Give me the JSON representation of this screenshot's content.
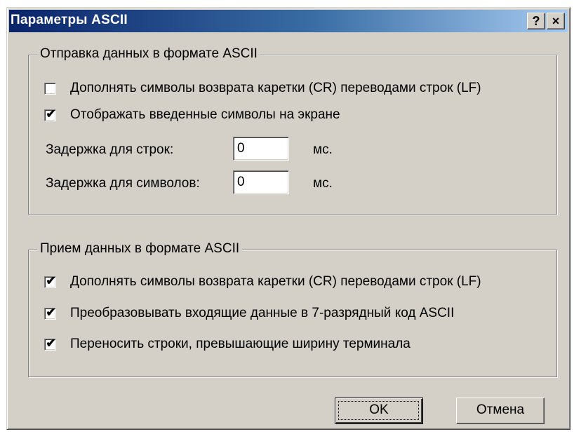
{
  "window": {
    "title": "Параметры ASCII",
    "help_glyph": "?",
    "close_glyph": "×"
  },
  "send_group": {
    "legend": "Отправка данных в формате ASCII",
    "options": [
      {
        "label": "Дополнять символы возврата каретки (CR) переводами строк (LF)",
        "checked": false
      },
      {
        "label": "Отображать введенные символы на экране",
        "checked": true
      }
    ],
    "line_delay": {
      "label": "Задержка для строк:",
      "value": "0",
      "unit": "мс."
    },
    "char_delay": {
      "label": "Задержка для символов:",
      "value": "0",
      "unit": "мс."
    }
  },
  "receive_group": {
    "legend": "Прием данных в формате ASCII",
    "options": [
      {
        "label": "Дополнять символы возврата каретки (CR) переводами строк (LF)",
        "checked": true
      },
      {
        "label": "Преобразовывать входящие данные в 7-разрядный код ASCII",
        "checked": true
      },
      {
        "label": "Переносить строки, превышающие ширину терминала",
        "checked": true
      }
    ]
  },
  "buttons": {
    "ok": "OK",
    "cancel": "Отмена"
  },
  "colors": {
    "dialog_face": "#d4d0c8",
    "title_start": "#0a246a",
    "title_end": "#a6caf0"
  },
  "icons": {
    "check": "check-mark-icon",
    "help": "help-icon",
    "close": "close-icon"
  }
}
